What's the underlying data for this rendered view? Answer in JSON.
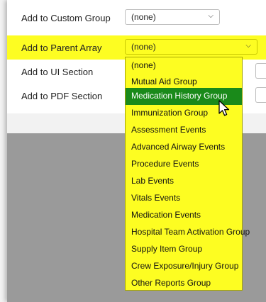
{
  "rows": [
    {
      "label": "Add to Custom Group",
      "value": "(none)"
    },
    {
      "label": "Add to Parent Array",
      "value": "(none)"
    },
    {
      "label": "Add to UI Section"
    },
    {
      "label": "Add to PDF Section"
    }
  ],
  "dropdown": {
    "options": [
      "(none)",
      "Mutual Aid Group",
      "Medication History Group",
      "Immunization Group",
      "Assessment Events",
      "Advanced Airway Events",
      "Procedure Events",
      "Lab Events",
      "Vitals Events",
      "Medication Events",
      "Hospital Team Activation Group",
      "Supply Item Group",
      "Crew Exposure/Injury Group",
      "Other Reports Group"
    ],
    "hovered_option": "Medication History Group"
  },
  "icons": {
    "chevron": "chevron-down-icon",
    "cursor": "pointer-cursor-icon"
  },
  "colors": {
    "highlight": "#fdfd22",
    "selected": "#1a8a1a",
    "overlay": "#9a9a9a"
  }
}
